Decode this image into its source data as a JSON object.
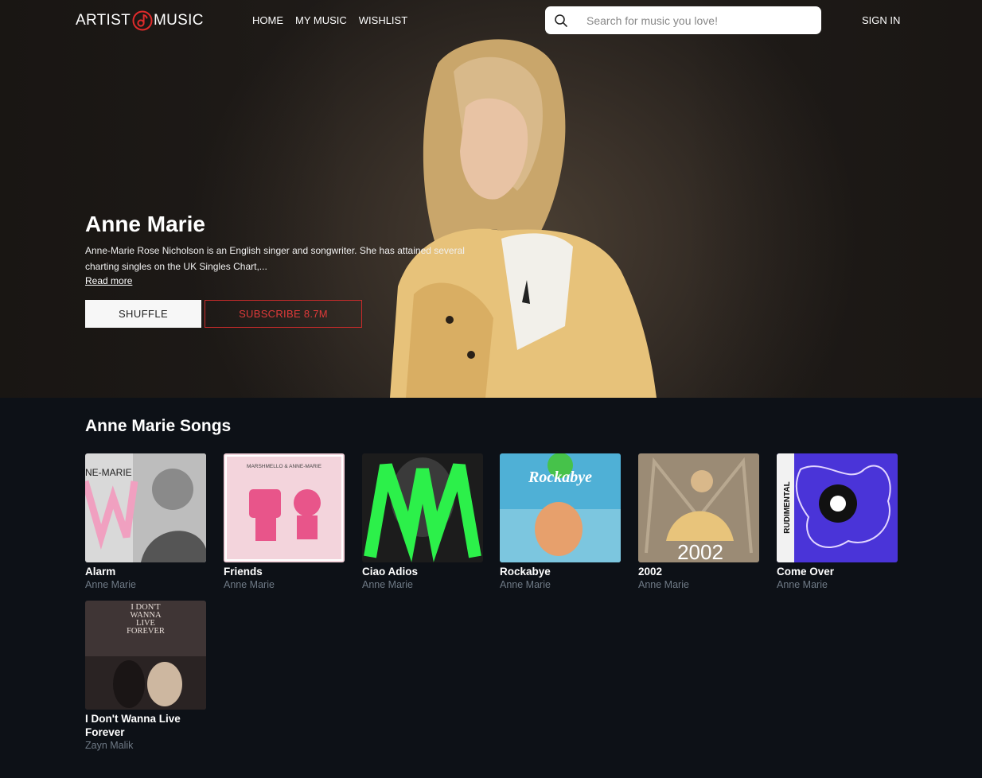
{
  "nav": {
    "logo_left": "ARTIST",
    "logo_right": "MUSIC",
    "links": [
      "HOME",
      "MY MUSIC",
      "WISHLIST"
    ],
    "search_placeholder": "Search for music you love!",
    "signin": "SIGN IN"
  },
  "hero": {
    "artist_name": "Anne Marie",
    "bio": "Anne-Marie Rose Nicholson is an English singer and songwriter. She has attained several charting singles on the UK Singles Chart,...",
    "read_more": "Read more",
    "shuffle_label": "SHUFFLE",
    "subscribe_label": "SUBSCRIBE 8.7M"
  },
  "songs": {
    "heading": "Anne Marie Songs",
    "items": [
      {
        "title": "Alarm",
        "artist": "Anne Marie",
        "cover_text": "NE-MARIE"
      },
      {
        "title": "Friends",
        "artist": "Anne Marie",
        "cover_text": "MARSHMELLO & ANNE-MARIE"
      },
      {
        "title": "Ciao Adios",
        "artist": "Anne Marie"
      },
      {
        "title": "Rockabye",
        "artist": "Anne Marie",
        "cover_text": "Rockabye"
      },
      {
        "title": "2002",
        "artist": "Anne Marie",
        "cover_text": "2002"
      },
      {
        "title": "Come Over",
        "artist": "Anne Marie",
        "cover_text": "RUDIMENTAL"
      },
      {
        "title": "I Don't Wanna Live Forever",
        "artist": "Zayn Malik",
        "cover_text": "I DON'T WANNA LIVE FOREVER"
      }
    ]
  },
  "colors": {
    "accent_red": "#e03a3a",
    "page_bg": "#0d1117",
    "muted_text": "#6f7a86"
  }
}
